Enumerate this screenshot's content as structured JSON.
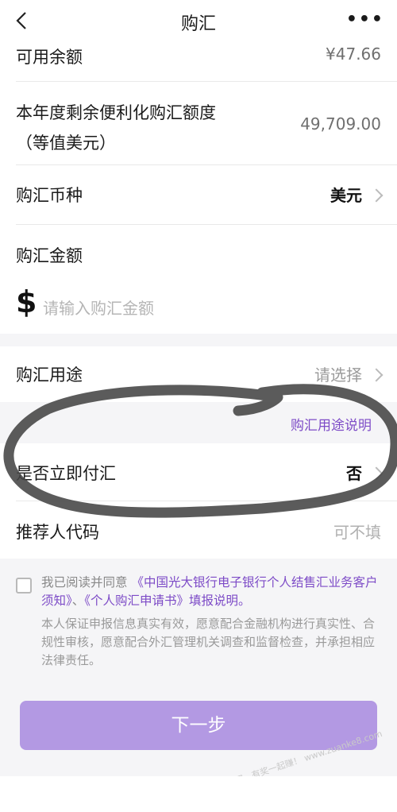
{
  "header": {
    "title": "购汇",
    "more": "•••"
  },
  "available": {
    "label": "可用余额",
    "value": "¥47.66"
  },
  "quota": {
    "label_line1": "本年度剩余便利化购汇额度",
    "label_line2": "（等值美元）",
    "value": "49,709.00"
  },
  "currency": {
    "label": "购汇币种",
    "value": "美元"
  },
  "amount": {
    "label": "购汇金额",
    "symbol": "$",
    "placeholder": "请输入购汇金额"
  },
  "purpose": {
    "label": "购汇用途",
    "value": "请选择",
    "link": "购汇用途说明"
  },
  "immediate": {
    "label": "是否立即付汇",
    "value": "否"
  },
  "referrer": {
    "label": "推荐人代码",
    "placeholder": "可不填"
  },
  "agreement": {
    "prefix": "我已阅读并同意",
    "doc1": "《中国光大银行电子银行个人结售汇业务客户须知》",
    "sep": "、",
    "doc2": "《个人购汇申请书》",
    "suffix": "填报说明。",
    "note": "本人保证申报信息真实有效，愿意配合金融机构进行真实性、合规性审核，愿意配合外汇管理机关调查和监督检查，并承担相应法律责任。"
  },
  "next_button": "下一步",
  "watermark": "赚客吧，有奖一起赚！ www.zuanke8.com"
}
